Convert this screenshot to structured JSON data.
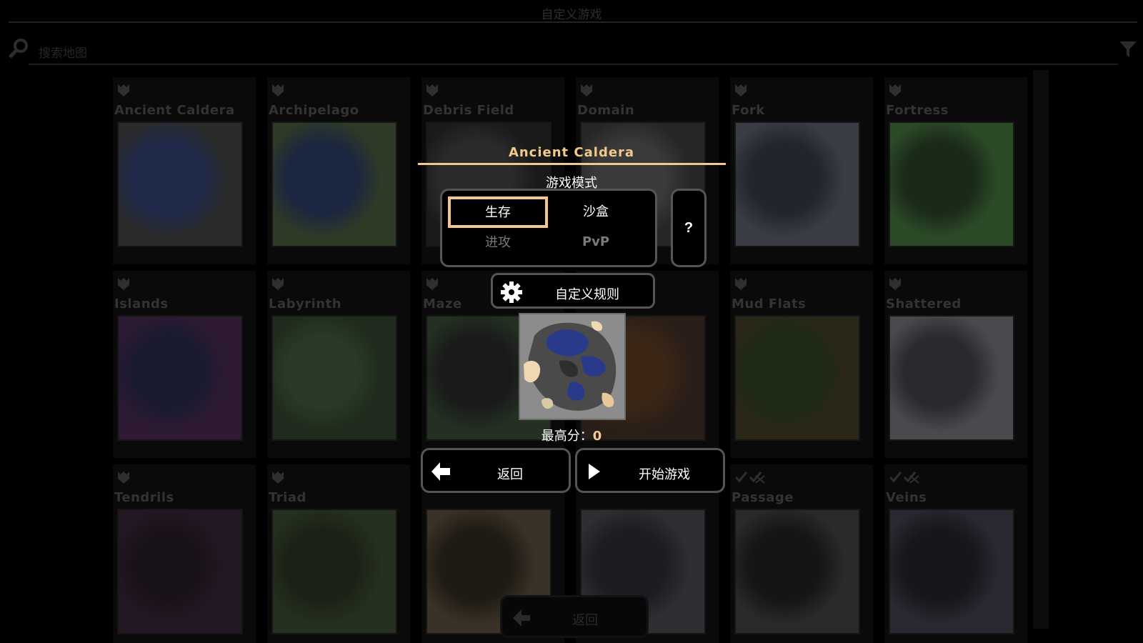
{
  "header": {
    "title": "自定义游戏"
  },
  "search": {
    "placeholder": "搜索地图"
  },
  "maps": [
    {
      "name": "Ancient Caldera",
      "icon": "shield-icon",
      "thumb": "#2b2b2b",
      "accent": "#1f2a4a"
    },
    {
      "name": "Archipelago",
      "icon": "shield-icon",
      "thumb": "#2f3a26",
      "accent": "#1b2640"
    },
    {
      "name": "Debris Field",
      "icon": "shield-icon",
      "thumb": "#1a1a1a",
      "accent": "#2b2b2b"
    },
    {
      "name": "Domain",
      "icon": "shield-icon",
      "thumb": "#262626",
      "accent": "#3a3a3a"
    },
    {
      "name": "Fork",
      "icon": "shield-icon",
      "thumb": "#3a3d45",
      "accent": "#22252e"
    },
    {
      "name": "Fortress",
      "icon": "shield-icon",
      "thumb": "#2c4a28",
      "accent": "#1a2a18"
    },
    {
      "name": "Islands",
      "icon": "shield-icon",
      "thumb": "#2e1a33",
      "accent": "#1a1a2e"
    },
    {
      "name": "Labyrinth",
      "icon": "shield-icon",
      "thumb": "#1f2b1c",
      "accent": "#2a3a26"
    },
    {
      "name": "Maze",
      "icon": "shield-icon",
      "thumb": "#233022",
      "accent": "#1a1a1a"
    },
    {
      "name": "",
      "icon": "shield-icon",
      "thumb": "#2a1e18",
      "accent": "#3b2615"
    },
    {
      "name": "Mud Flats",
      "icon": "shield-icon",
      "thumb": "#2a2618",
      "accent": "#1c2a16"
    },
    {
      "name": "Shattered",
      "icon": "shield-icon",
      "thumb": "#4a4a4e",
      "accent": "#2a2a2e"
    },
    {
      "name": "Tendrils",
      "icon": "shield-icon",
      "thumb": "#241824",
      "accent": "#1a121a"
    },
    {
      "name": "Triad",
      "icon": "shield-icon",
      "thumb": "#26301e",
      "accent": "#1a2216"
    },
    {
      "name": "",
      "icon": "shield-icon",
      "thumb": "#3a3226",
      "accent": "#1e1a14"
    },
    {
      "name": "",
      "icon": "shield-icon",
      "thumb": "#2e2e33",
      "accent": "#1c1c22"
    },
    {
      "name": "Passage",
      "icon": "checks-icon",
      "thumb": "#2a2a2a",
      "accent": "#151515"
    },
    {
      "name": "Veins",
      "icon": "checks-icon",
      "thumb": "#2a2830",
      "accent": "#18161c"
    }
  ],
  "dialog": {
    "title": "Ancient Caldera",
    "mode_label": "游戏模式",
    "modes": {
      "survival": "生存",
      "sandbox": "沙盒",
      "attack": "进攻",
      "pvp": "PvP"
    },
    "help_label": "?",
    "rules_label": "自定义规则",
    "score_label": "最高分：",
    "score_value": "0",
    "back_label": "返回",
    "start_label": "开始游戏"
  },
  "bottom": {
    "back_label": "返回"
  },
  "colors": {
    "accent": "#f3c98b",
    "border": "#555555",
    "background": "#000000"
  }
}
